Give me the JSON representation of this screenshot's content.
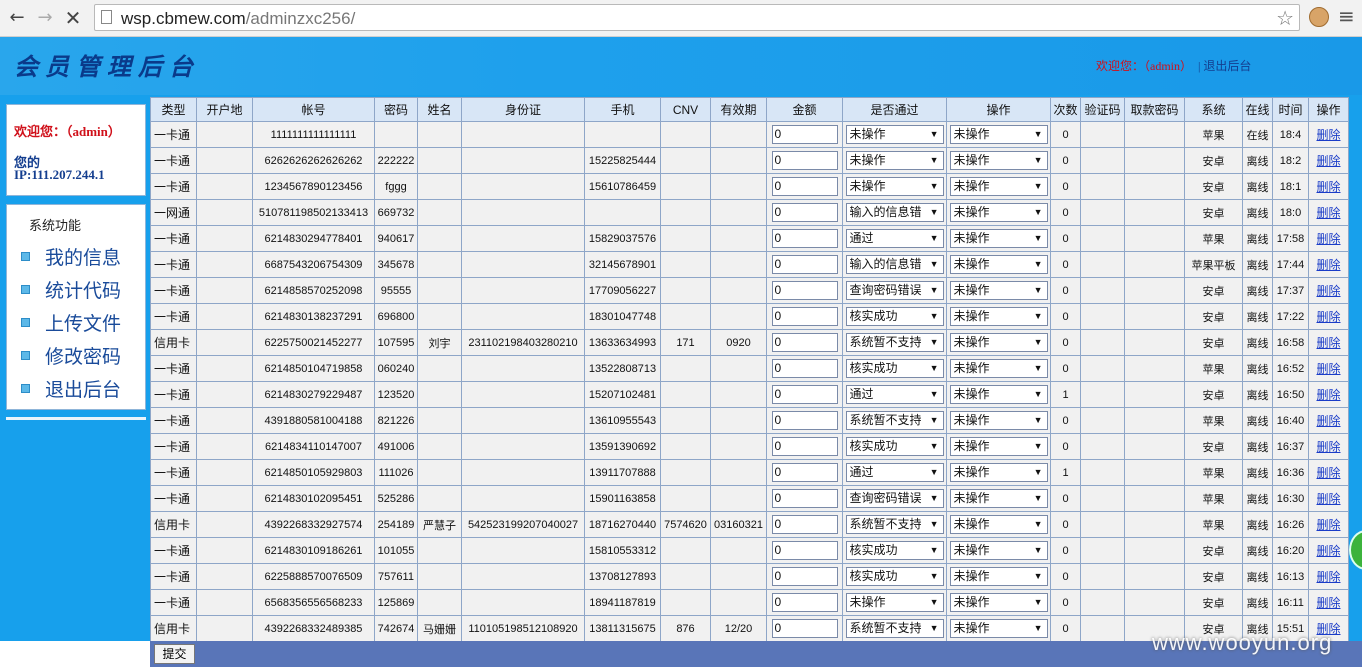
{
  "browser": {
    "url_host": "wsp.cbmew.com",
    "url_path": "/adminzxc256/"
  },
  "header": {
    "logo": "会员管理后台",
    "welcome_prefix": "欢迎您：",
    "user": "（admin）",
    "logout": "| 退出后台"
  },
  "sidebar": {
    "welcome": "欢迎您：（admin）",
    "ip_label": "您的",
    "ip_value": "IP:111.207.244.1",
    "title": "系统功能",
    "items": [
      {
        "label": "我的信息"
      },
      {
        "label": "统计代码"
      },
      {
        "label": "上传文件"
      },
      {
        "label": "修改密码"
      },
      {
        "label": "退出后台"
      }
    ]
  },
  "table": {
    "headers": [
      "类型",
      "开户地",
      "帐号",
      "密码",
      "姓名",
      "身份证",
      "手机",
      "CNV",
      "有效期",
      "金额",
      "是否通过",
      "操作",
      "次数",
      "验证码",
      "取款密码",
      "系统",
      "在线",
      "时间",
      "操作"
    ],
    "delete_label": "删除",
    "op_label": "未操作",
    "rows": [
      {
        "type": "一卡通",
        "loc": "",
        "acct": "1111111111111111",
        "pwd": "",
        "name": "",
        "id": "",
        "phone": "",
        "cnv": "",
        "exp": "",
        "amt": "0",
        "pass": "未操作",
        "op": "未操作",
        "cnt": "0",
        "code": "",
        "wpwd": "",
        "sys": "苹果",
        "online": "在线",
        "time": "18:4"
      },
      {
        "type": "一卡通",
        "loc": "",
        "acct": "6262626262626262",
        "pwd": "222222",
        "name": "",
        "id": "",
        "phone": "15225825444",
        "cnv": "",
        "exp": "",
        "amt": "0",
        "pass": "未操作",
        "op": "未操作",
        "cnt": "0",
        "code": "",
        "wpwd": "",
        "sys": "安卓",
        "online": "离线",
        "time": "18:2"
      },
      {
        "type": "一卡通",
        "loc": "",
        "acct": "1234567890123456",
        "pwd": "fggg",
        "name": "",
        "id": "",
        "phone": "15610786459",
        "cnv": "",
        "exp": "",
        "amt": "0",
        "pass": "未操作",
        "op": "未操作",
        "cnt": "0",
        "code": "",
        "wpwd": "",
        "sys": "安卓",
        "online": "离线",
        "time": "18:1"
      },
      {
        "type": "一网通",
        "loc": "",
        "acct": "510781198502133413",
        "pwd": "669732",
        "name": "",
        "id": "",
        "phone": "",
        "cnv": "",
        "exp": "",
        "amt": "0",
        "pass": "输入的信息错",
        "op": "未操作",
        "cnt": "0",
        "code": "",
        "wpwd": "",
        "sys": "安卓",
        "online": "离线",
        "time": "18:0"
      },
      {
        "type": "一卡通",
        "loc": "",
        "acct": "6214830294778401",
        "pwd": "940617",
        "name": "",
        "id": "",
        "phone": "15829037576",
        "cnv": "",
        "exp": "",
        "amt": "0",
        "pass": "通过",
        "op": "未操作",
        "cnt": "0",
        "code": "",
        "wpwd": "",
        "sys": "苹果",
        "online": "离线",
        "time": "17:58"
      },
      {
        "type": "一卡通",
        "loc": "",
        "acct": "6687543206754309",
        "pwd": "345678",
        "name": "",
        "id": "",
        "phone": "32145678901",
        "cnv": "",
        "exp": "",
        "amt": "0",
        "pass": "输入的信息错",
        "op": "未操作",
        "cnt": "0",
        "code": "",
        "wpwd": "",
        "sys": "苹果平板",
        "online": "离线",
        "time": "17:44"
      },
      {
        "type": "一卡通",
        "loc": "",
        "acct": "6214858570252098",
        "pwd": "95555",
        "name": "",
        "id": "",
        "phone": "17709056227",
        "cnv": "",
        "exp": "",
        "amt": "0",
        "pass": "查询密码错误",
        "op": "未操作",
        "cnt": "0",
        "code": "",
        "wpwd": "",
        "sys": "安卓",
        "online": "离线",
        "time": "17:37"
      },
      {
        "type": "一卡通",
        "loc": "",
        "acct": "6214830138237291",
        "pwd": "696800",
        "name": "",
        "id": "",
        "phone": "18301047748",
        "cnv": "",
        "exp": "",
        "amt": "0",
        "pass": "核实成功",
        "op": "未操作",
        "cnt": "0",
        "code": "",
        "wpwd": "",
        "sys": "安卓",
        "online": "离线",
        "time": "17:22"
      },
      {
        "type": "信用卡",
        "loc": "",
        "acct": "6225750021452277",
        "pwd": "107595",
        "name": "刘宇",
        "id": "231102198403280210",
        "phone": "13633634993",
        "cnv": "171",
        "exp": "0920",
        "amt": "0",
        "pass": "系统暂不支持",
        "op": "未操作",
        "cnt": "0",
        "code": "",
        "wpwd": "",
        "sys": "安卓",
        "online": "离线",
        "time": "16:58"
      },
      {
        "type": "一卡通",
        "loc": "",
        "acct": "6214850104719858",
        "pwd": "060240",
        "name": "",
        "id": "",
        "phone": "13522808713",
        "cnv": "",
        "exp": "",
        "amt": "0",
        "pass": "核实成功",
        "op": "未操作",
        "cnt": "0",
        "code": "",
        "wpwd": "",
        "sys": "苹果",
        "online": "离线",
        "time": "16:52"
      },
      {
        "type": "一卡通",
        "loc": "",
        "acct": "6214830279229487",
        "pwd": "123520",
        "name": "",
        "id": "",
        "phone": "15207102481",
        "cnv": "",
        "exp": "",
        "amt": "0",
        "pass": "通过",
        "op": "未操作",
        "cnt": "1",
        "code": "",
        "wpwd": "",
        "sys": "安卓",
        "online": "离线",
        "time": "16:50"
      },
      {
        "type": "一卡通",
        "loc": "",
        "acct": "4391880581004188",
        "pwd": "821226",
        "name": "",
        "id": "",
        "phone": "13610955543",
        "cnv": "",
        "exp": "",
        "amt": "0",
        "pass": "系统暂不支持",
        "op": "未操作",
        "cnt": "0",
        "code": "",
        "wpwd": "",
        "sys": "苹果",
        "online": "离线",
        "time": "16:40"
      },
      {
        "type": "一卡通",
        "loc": "",
        "acct": "6214834110147007",
        "pwd": "491006",
        "name": "",
        "id": "",
        "phone": "13591390692",
        "cnv": "",
        "exp": "",
        "amt": "0",
        "pass": "核实成功",
        "op": "未操作",
        "cnt": "0",
        "code": "",
        "wpwd": "",
        "sys": "安卓",
        "online": "离线",
        "time": "16:37"
      },
      {
        "type": "一卡通",
        "loc": "",
        "acct": "6214850105929803",
        "pwd": "111026",
        "name": "",
        "id": "",
        "phone": "13911707888",
        "cnv": "",
        "exp": "",
        "amt": "0",
        "pass": "通过",
        "op": "未操作",
        "cnt": "1",
        "code": "",
        "wpwd": "",
        "sys": "苹果",
        "online": "离线",
        "time": "16:36"
      },
      {
        "type": "一卡通",
        "loc": "",
        "acct": "6214830102095451",
        "pwd": "525286",
        "name": "",
        "id": "",
        "phone": "15901163858",
        "cnv": "",
        "exp": "",
        "amt": "0",
        "pass": "查询密码错误",
        "op": "未操作",
        "cnt": "0",
        "code": "",
        "wpwd": "",
        "sys": "苹果",
        "online": "离线",
        "time": "16:30"
      },
      {
        "type": "信用卡",
        "loc": "",
        "acct": "4392268332927574",
        "pwd": "254189",
        "name": "严慧子",
        "id": "542523199207040027",
        "phone": "18716270440",
        "cnv": "7574620",
        "exp": "03160321",
        "amt": "0",
        "pass": "系统暂不支持",
        "op": "未操作",
        "cnt": "0",
        "code": "",
        "wpwd": "",
        "sys": "苹果",
        "online": "离线",
        "time": "16:26"
      },
      {
        "type": "一卡通",
        "loc": "",
        "acct": "6214830109186261",
        "pwd": "101055",
        "name": "",
        "id": "",
        "phone": "15810553312",
        "cnv": "",
        "exp": "",
        "amt": "0",
        "pass": "核实成功",
        "op": "未操作",
        "cnt": "0",
        "code": "",
        "wpwd": "",
        "sys": "安卓",
        "online": "离线",
        "time": "16:20"
      },
      {
        "type": "一卡通",
        "loc": "",
        "acct": "6225888570076509",
        "pwd": "757611",
        "name": "",
        "id": "",
        "phone": "13708127893",
        "cnv": "",
        "exp": "",
        "amt": "0",
        "pass": "核实成功",
        "op": "未操作",
        "cnt": "0",
        "code": "",
        "wpwd": "",
        "sys": "安卓",
        "online": "离线",
        "time": "16:13"
      },
      {
        "type": "一卡通",
        "loc": "",
        "acct": "6568356556568233",
        "pwd": "125869",
        "name": "",
        "id": "",
        "phone": "18941187819",
        "cnv": "",
        "exp": "",
        "amt": "0",
        "pass": "未操作",
        "op": "未操作",
        "cnt": "0",
        "code": "",
        "wpwd": "",
        "sys": "安卓",
        "online": "离线",
        "time": "16:11"
      },
      {
        "type": "信用卡",
        "loc": "",
        "acct": "4392268332489385",
        "pwd": "742674",
        "name": "马姗姗",
        "id": "110105198512108920",
        "phone": "13811315675",
        "cnv": "876",
        "exp": "12/20",
        "amt": "0",
        "pass": "系统暂不支持",
        "op": "未操作",
        "cnt": "0",
        "code": "",
        "wpwd": "",
        "sys": "安卓",
        "online": "离线",
        "time": "15:51"
      }
    ]
  },
  "footer": {
    "submit": "提交",
    "watermark": "www.wooyun.org"
  }
}
